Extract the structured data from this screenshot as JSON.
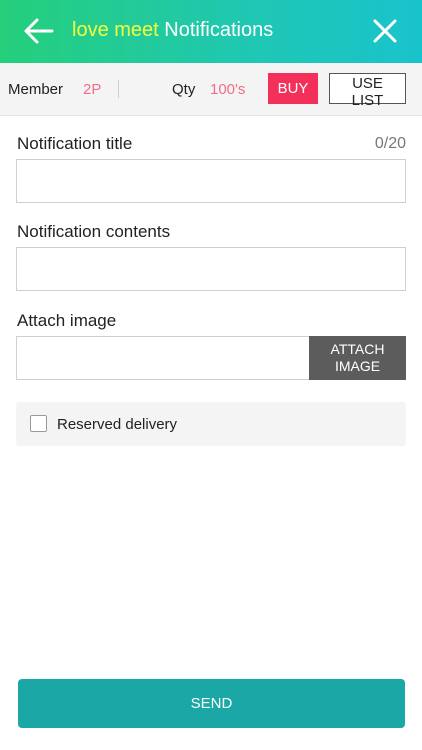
{
  "header": {
    "title_brand": "love meet",
    "title_main": "Notifications",
    "back_icon": "arrow-left-icon",
    "close_icon": "close-icon"
  },
  "subbar": {
    "member_label": "Member",
    "member_value": "2P",
    "qty_label": "Qty",
    "qty_value": "100's",
    "buy_label": "BUY",
    "use_list_label": "USE LIST"
  },
  "form": {
    "title_label": "Notification title",
    "title_counter": "0/20",
    "title_value": "",
    "contents_label": "Notification contents",
    "contents_value": "",
    "attach_label": "Attach image",
    "attach_value": "",
    "attach_button_line1": "ATTACH",
    "attach_button_line2": "IMAGE",
    "reserved_label": "Reserved delivery",
    "reserved_checked": false
  },
  "footer": {
    "send_label": "SEND"
  },
  "colors": {
    "header_gradient_start": "#25cf7a",
    "header_gradient_end": "#19c3cc",
    "brand_text": "#f3ff3c",
    "accent_pink": "#f06d86",
    "buy_red": "#f2305a",
    "send_teal": "#1aa7a6",
    "attach_gray": "#5c5c5c"
  }
}
